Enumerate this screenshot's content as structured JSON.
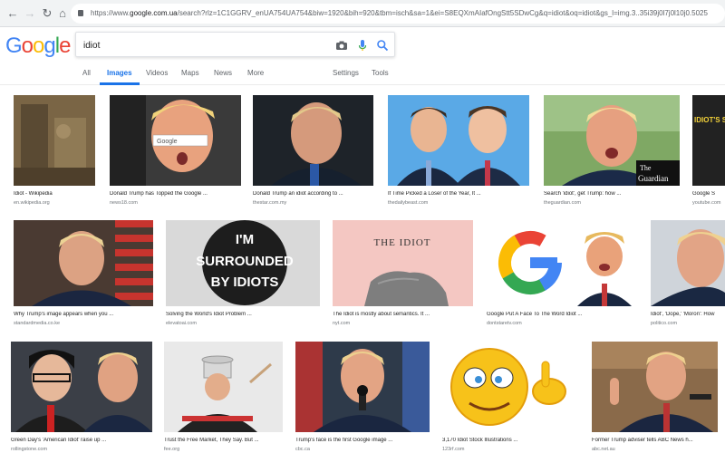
{
  "browser": {
    "url": "https://www.google.com.ua/search?q=idiot&tbm=isch",
    "url_prefix": "https://www.",
    "url_host": "google.com.ua",
    "url_path": "/search?rlz=1C1GGRV_enUA754UA754&biw=1920&bih=920&tbm=isch&sa=1&ei=S8EQXmAIafOngStt5SDwCg&q=idiot&oq=idiot&gs_l=img.3..35i39j0l7j0l10j0.5025"
  },
  "search": {
    "query": "idiot"
  },
  "tabs": [
    "All",
    "Images",
    "Videos",
    "Maps",
    "News",
    "More"
  ],
  "tools": [
    "Settings",
    "Tools"
  ],
  "row1": [
    {
      "caption": "Idiot - Wikipedia",
      "source": "en.wikipedia.org"
    },
    {
      "caption": "Donald Trump has Topped the Google ...",
      "source": "news18.com"
    },
    {
      "caption": "Donald Trump an idiot according to ...",
      "source": "thestar.com.my"
    },
    {
      "caption": "If Time Picked a Loser of the Year, It ...",
      "source": "thedailybeast.com"
    },
    {
      "caption": "Search 'idiot', get Trump: how ...",
      "source": "theguardian.com"
    },
    {
      "caption": "Google S",
      "source": "youtube.com"
    }
  ],
  "row2": [
    {
      "caption": "Why Trump's image appears when you ...",
      "source": "standardmedia.co.ke"
    },
    {
      "caption": "Solving the World's Idiot Problem ...",
      "source": "elevatoai.com"
    },
    {
      "caption": "The Idiot is mostly about semantics. It ...",
      "source": "nyt.com"
    },
    {
      "caption": "Google Put A Face To The Word Idiot ...",
      "source": "dontstaretv.com"
    },
    {
      "caption": "Idiot', 'Dope,' 'Moron': How",
      "source": "politico.com"
    }
  ],
  "row3": [
    {
      "caption": "Green Day's 'American Idiot' raise up ...",
      "source": "rollingstone.com"
    },
    {
      "caption": "Trust the Free Market, They Say. But ...",
      "source": "fee.org"
    },
    {
      "caption": "Trump's face is the first Google image ...",
      "source": "cbc.ca"
    },
    {
      "caption": "3,170 Idiot Stock Illustrations ...",
      "source": "123rf.com"
    },
    {
      "caption": "Former Trump adviser tells ABC News h...",
      "source": "abc.net.au"
    }
  ],
  "image_text": {
    "googlebox": "Google",
    "guardian1": "The",
    "guardian2": "Guardian",
    "idiots_sign": "IDIOT'S SEARCH IS TR",
    "button1": "I'M",
    "button2": "SURROUNDED",
    "button3": "BY IDIOTS",
    "book": "THE IDIOT"
  },
  "colors": {
    "accent": "#1a73e8",
    "g_blue": "#4285f4",
    "g_red": "#ea4335",
    "g_yellow": "#fbbc05",
    "g_green": "#34a853"
  }
}
